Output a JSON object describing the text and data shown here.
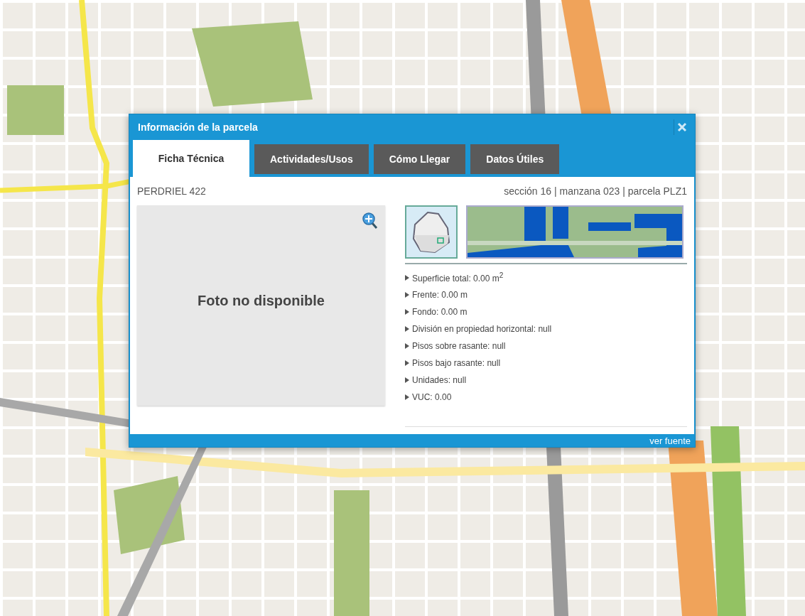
{
  "dialog": {
    "title": "Información de la parcela",
    "tabs": [
      {
        "label": "Ficha Técnica",
        "selected": true
      },
      {
        "label": "Actividades/Usos",
        "selected": false
      },
      {
        "label": "Cómo Llegar",
        "selected": false
      },
      {
        "label": "Datos Útiles",
        "selected": false
      }
    ],
    "address": "PERDRIEL 422",
    "cadastre": "sección 16 | manzana 023 | parcela PLZ1",
    "photo": {
      "message": "Foto no disponible"
    },
    "details": [
      "Superficie total: 0.00 m$^{2}$",
      "Frente: 0.00 m",
      "Fondo: 0.00 m",
      "División en propiedad horizontal: null",
      "Pisos sobre rasante: null",
      "Pisos bajo rasante: null",
      "Unidades: null",
      "VUC: 0.00"
    ],
    "source_link": "ver fuente"
  }
}
